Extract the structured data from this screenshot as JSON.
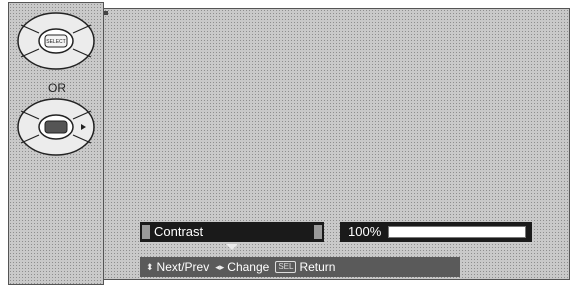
{
  "left_panel": {
    "or_label": "OR",
    "select_button_text": "SELECT"
  },
  "osd": {
    "setting_label": "Contrast",
    "value_text": "100%",
    "value_fraction": 1.0
  },
  "help_bar": {
    "next_prev_label": "Next/Prev",
    "change_label": "Change",
    "sel_badge": "SEL",
    "return_label": "Return"
  }
}
